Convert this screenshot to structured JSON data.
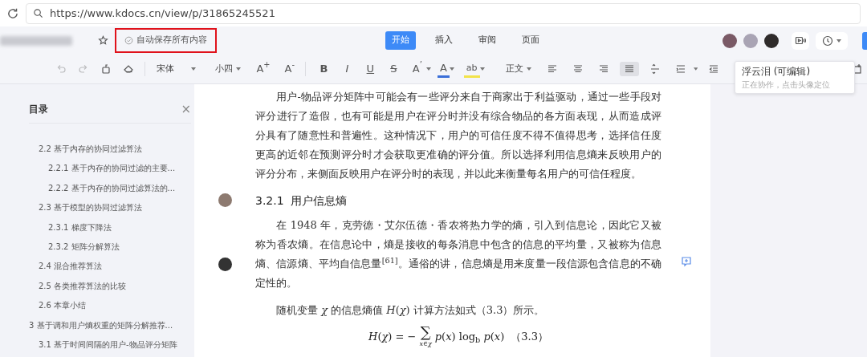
{
  "browser": {
    "url": "https://www.kdocs.cn/view/p/31865245521"
  },
  "header": {
    "autosave": {
      "label": "自动保存所有内容",
      "highlighted": true
    },
    "tabs": [
      {
        "label": "开始",
        "selected": true
      },
      {
        "label": "插入",
        "selected": false
      },
      {
        "label": "审阅",
        "selected": false
      },
      {
        "label": "页面",
        "selected": false
      }
    ]
  },
  "toolbar": {
    "history": [
      {
        "kind": "undo",
        "disabled": true
      },
      {
        "kind": "redo",
        "disabled": true
      }
    ],
    "font": "宋体",
    "size": "小四",
    "size_buttons": [
      "A$^{+}$",
      "A$^{-}$"
    ],
    "format_buttons": [
      {
        "label": "B",
        "kind": "bold"
      },
      {
        "label": "I",
        "kind": "italic"
      },
      {
        "label": "U",
        "kind": "underline"
      },
      {
        "label": "S",
        "kind": "strike"
      }
    ],
    "effects_button": "A$^{’}$",
    "font_color": {
      "label": "A",
      "color": "#3b6fd8"
    },
    "highlight": {
      "label": "ab",
      "color": "#f2e34a"
    },
    "style": "正文",
    "alignment": [
      {
        "kind": "left",
        "selected": false
      },
      {
        "kind": "center",
        "selected": false
      },
      {
        "kind": "right",
        "selected": false
      },
      {
        "kind": "justify",
        "selected": true
      }
    ]
  },
  "tooltip": {
    "title": "浮云泪 (可编辑)",
    "hint": "正在协作，点击头像定位"
  },
  "toc": {
    "title": "目录",
    "close": "×",
    "items": [
      {
        "children": [
          {
            "label": "2.2 基于内存的协同过滤算法",
            "children": [
              {
                "label": "2.2.1 基于内存的协同过滤的主要..."
              },
              {
                "label": "2.2.2 基于内存的协同过滤算法的..."
              }
            ]
          },
          {
            "label": "2.3 基于模型的协同过滤算法",
            "children": [
              {
                "label": "2.3.1 梯度下降法"
              },
              {
                "label": "2.3.2 矩阵分解算法"
              }
            ]
          },
          {
            "label": "2.4 混合推荐算法"
          },
          {
            "label": "2.5 各类推荐算法的比较"
          },
          {
            "label": "2.6 本章小结"
          }
        ]
      },
      {
        "label": "3 基于调和用户熵权重的矩阵分解推荐...",
        "children": [
          {
            "label": "3.1 基于时间间隔的用户-物品评分矩阵"
          }
        ]
      }
    ]
  },
  "document": [
    {
      "kind": "paragraph",
      "text": "用户-物品评分矩阵中可能会有一些评分来自于商家出于利益驱动，通过一些手段对评分进行了造假，也有可能是用户在评分时并没有综合物品的各方面表现，从而造成评分具有了随意性和普遍性。这种情况下，用户的可信任度不得不值得思考，选择信任度更高的近邻在预测评分时才会获取更准确的评分值。所以选择利用信息熵来反映用户的评分分布，来侧面反映用户在评分时的表现，并以此来衡量每名用户的可信任程度。"
    },
    {
      "kind": "heading",
      "number": "3.2.1",
      "text": "用户信息熵",
      "collaborator": true
    },
    {
      "kind": "paragraph",
      "text": "在 1948 年，克劳德・艾尔伍德・香农将热力学的熵，引入到信息论，因此它又被称为香农熵。在信息论中，熵是接收的每条消息中包含的信息的平均量，又被称为信息熵、信源熵、平均自信息量$^{[61]}$。通俗的讲，信息熵是用来度量一段信源包含信息的不确定性的。",
      "collaborator": true,
      "comment": true
    },
    {
      "kind": "paragraph",
      "text": "随机变量 *χ* 的信息熵值 *H*(*χ*) 计算方法如式（3.3）所示。"
    },
    {
      "kind": "formula",
      "lhs": "*H*(*χ*) = −",
      "sum": "∑",
      "under": "*x*∈*χ*",
      "rhs": "*p*(*x*) log$_{b}$ *p*(*x*)",
      "number": "（3.3）"
    }
  ]
}
